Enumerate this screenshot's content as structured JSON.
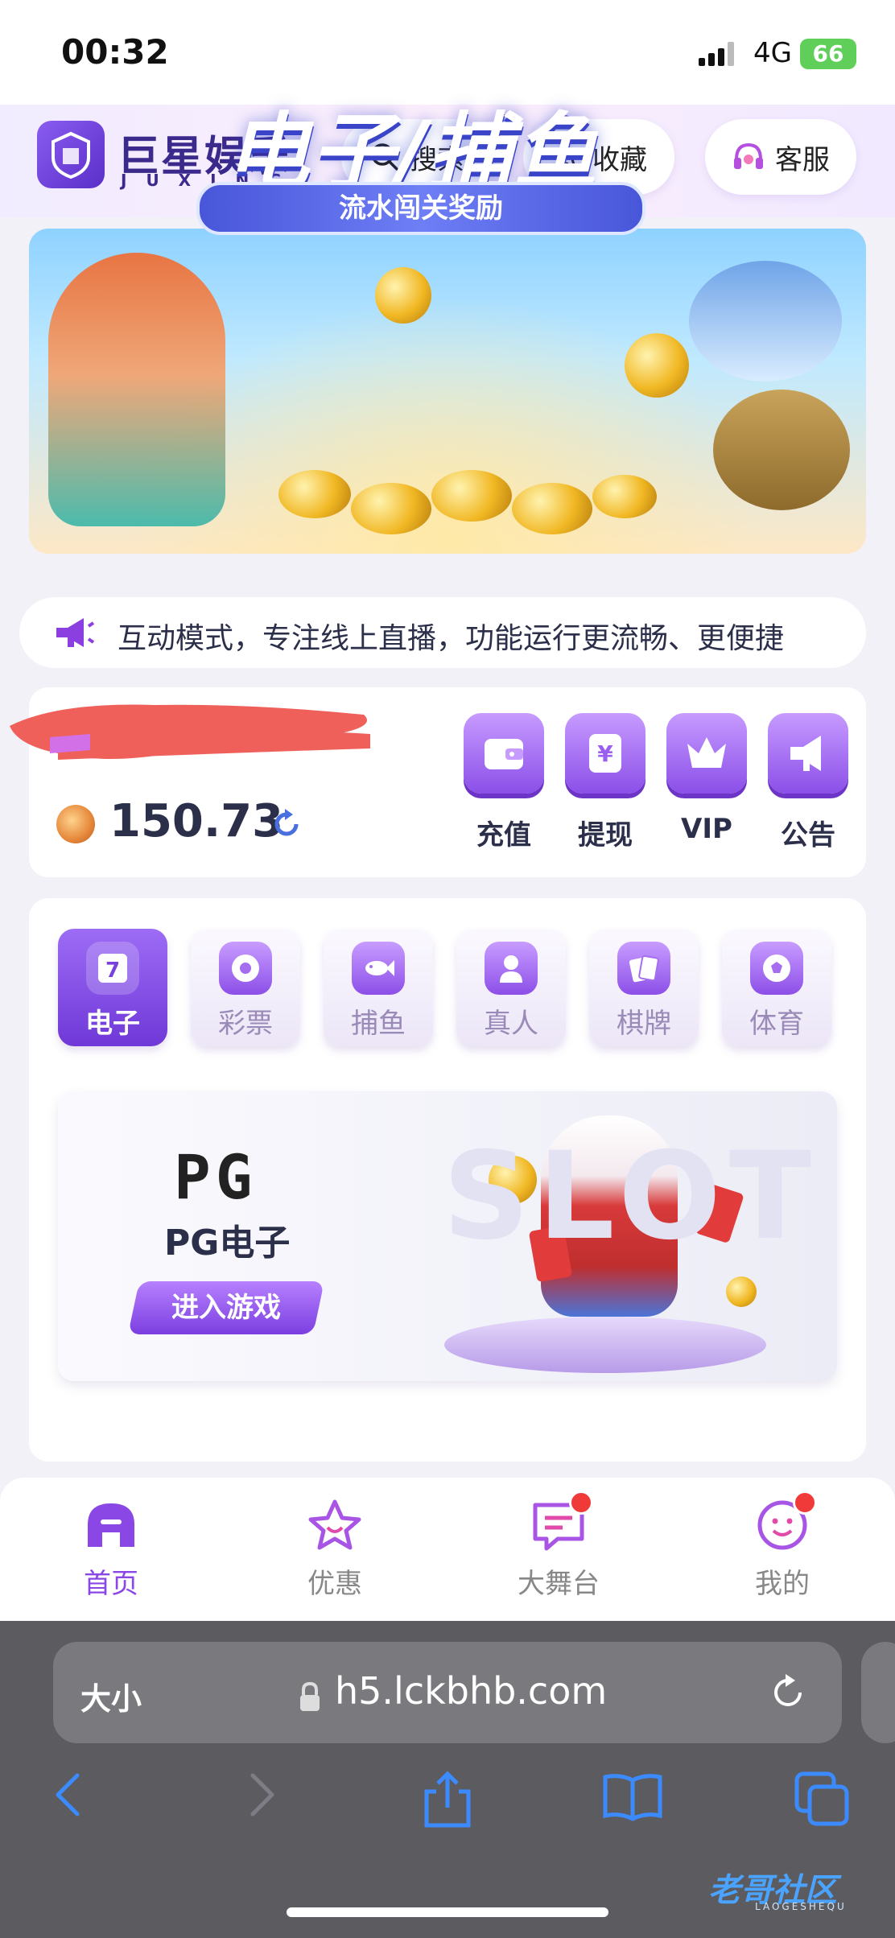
{
  "status_bar": {
    "time": "00:32",
    "network": "4G",
    "battery": "66"
  },
  "header": {
    "logo_title": "巨星娱乐",
    "logo_subtitle": "JUXING",
    "search_label": "搜索",
    "favorites_label": "收藏",
    "service_label": "客服"
  },
  "banner": {
    "title": "电子/捕鱼",
    "subtitle": "流水闯关奖励"
  },
  "announcement": {
    "text": "互动模式，专注线上直播，功能运行更流畅、更便捷"
  },
  "wallet": {
    "balance": "150.73",
    "actions": {
      "deposit": "充值",
      "withdraw": "提现",
      "vip": "VIP",
      "notice": "公告"
    }
  },
  "game_tabs": {
    "electronic": "电子",
    "lottery": "彩票",
    "fishing": "捕鱼",
    "live": "真人",
    "cards": "棋牌",
    "sports": "体育",
    "active": "电子"
  },
  "game_card": {
    "logo": "PG",
    "name": "PG电子",
    "enter_label": "进入游戏",
    "bg_text": "SLOT"
  },
  "bottom_nav": {
    "home": "首页",
    "promotions": "优惠",
    "stage": "大舞台",
    "mine": "我的"
  },
  "browser": {
    "text_size": "大小",
    "url": "h5.lckbhb.com"
  },
  "watermark": {
    "text": "老哥社区",
    "sub": "LAOGESHEQU"
  },
  "colors": {
    "accent": "#8b46e6",
    "badge": "#f03a3a"
  }
}
